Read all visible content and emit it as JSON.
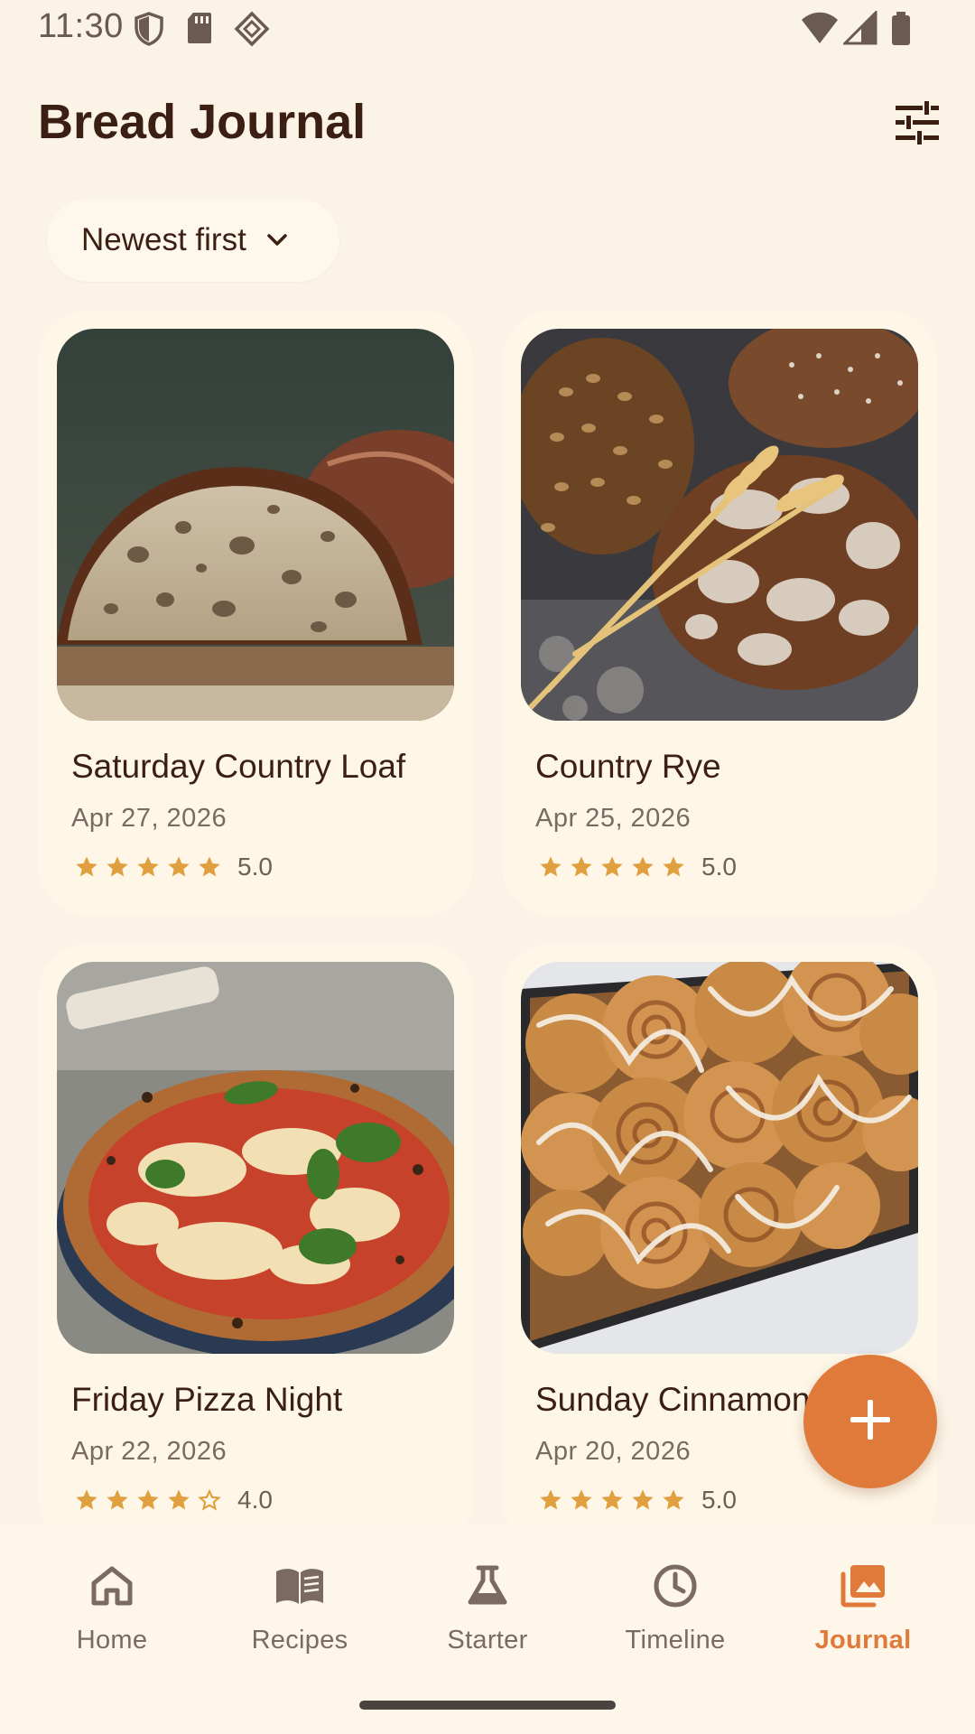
{
  "status_bar": {
    "time": "11:30",
    "left_icons": [
      "shield-icon",
      "sd-card-icon",
      "diamond-icon"
    ],
    "right_icons": [
      "wifi-icon",
      "signal-icon",
      "battery-icon"
    ]
  },
  "header": {
    "title": "Bread Journal",
    "filter_icon": "tune-icon"
  },
  "sort": {
    "label": "Newest first",
    "icon": "chevron-down-icon"
  },
  "entries": [
    {
      "title": "Saturday Country Loaf",
      "date": "Apr 27, 2026",
      "rating": 5,
      "rating_label": "5.0",
      "image": "sourdough-loaf-photo"
    },
    {
      "title": "Country Rye",
      "date": "Apr 25, 2026",
      "rating": 5,
      "rating_label": "5.0",
      "image": "rye-loaves-photo"
    },
    {
      "title": "Friday Pizza Night",
      "date": "Apr 22, 2026",
      "rating": 4,
      "rating_label": "4.0",
      "image": "pizza-photo"
    },
    {
      "title": "Sunday Cinnamon Rolls",
      "date": "Apr 20, 2026",
      "rating": 5,
      "rating_label": "5.0",
      "image": "cinnamon-rolls-photo"
    }
  ],
  "fab": {
    "icon": "plus-icon"
  },
  "bottom_nav": {
    "items": [
      {
        "label": "Home",
        "icon": "home-icon"
      },
      {
        "label": "Recipes",
        "icon": "book-icon"
      },
      {
        "label": "Starter",
        "icon": "flask-icon"
      },
      {
        "label": "Timeline",
        "icon": "clock-icon"
      },
      {
        "label": "Journal",
        "icon": "photo-library-icon",
        "active": true
      }
    ]
  },
  "colors": {
    "background": "#fbf3e6",
    "card": "#fef7e8",
    "accent": "#e07a3a",
    "star": "#e0a040",
    "text_primary": "#3a1f12",
    "text_secondary": "#7a6a60"
  }
}
